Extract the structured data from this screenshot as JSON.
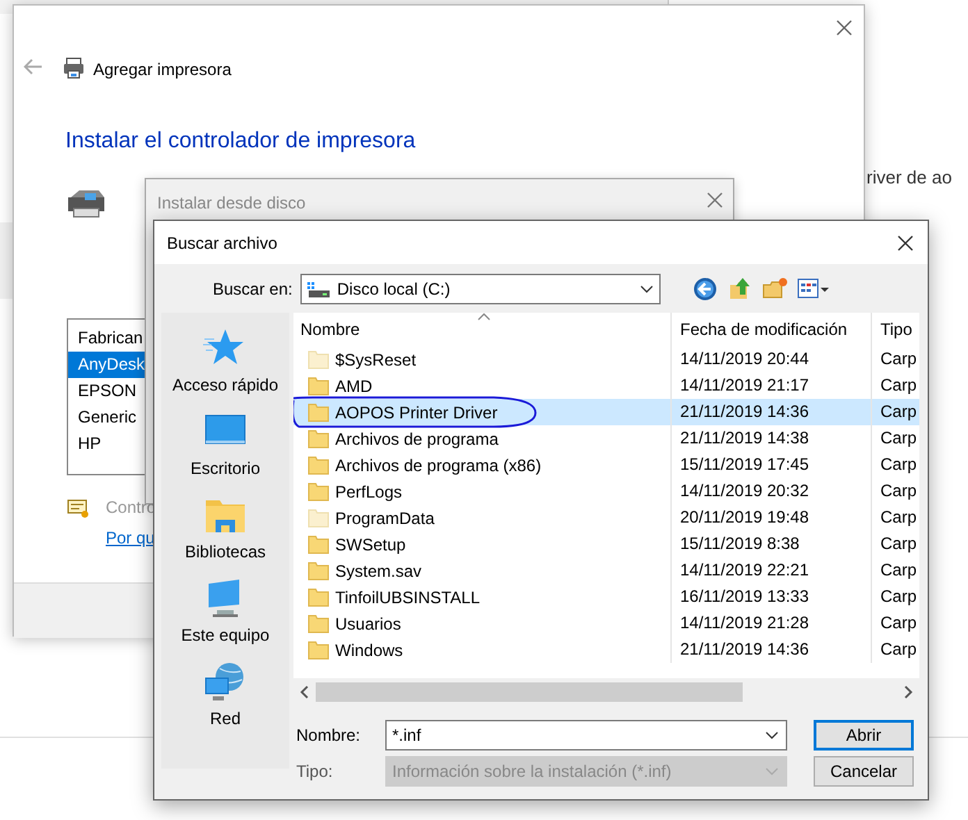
{
  "background": {
    "fragments": [
      "river de ao"
    ]
  },
  "add_printer_window": {
    "title": "Agregar impresora",
    "heading": "Instalar el controlador de impresora",
    "manufacturer_list": {
      "header": "Fabrican",
      "items": [
        {
          "label": "AnyDesk",
          "selected": true
        },
        {
          "label": "EPSON",
          "selected": false
        },
        {
          "label": "Generic",
          "selected": false
        },
        {
          "label": "HP",
          "selected": false
        }
      ]
    },
    "signed_text": "Contro",
    "link": "Por qu"
  },
  "install_from_disk_window": {
    "title": "Instalar desde disco"
  },
  "browse_dialog": {
    "title": "Buscar archivo",
    "look_in_label": "Buscar en:",
    "look_in_value": "Disco local (C:)",
    "places": [
      {
        "kind": "quick",
        "label": "Acceso rápido"
      },
      {
        "kind": "desktop",
        "label": "Escritorio"
      },
      {
        "kind": "libraries",
        "label": "Bibliotecas"
      },
      {
        "kind": "computer",
        "label": "Este equipo"
      },
      {
        "kind": "network",
        "label": "Red"
      }
    ],
    "columns": [
      "Nombre",
      "Fecha de modificación",
      "Tipo"
    ],
    "rows": [
      {
        "name": "$SysReset",
        "date": "14/11/2019 20:44",
        "type": "Carp",
        "hidden": true,
        "selected": false
      },
      {
        "name": "AMD",
        "date": "14/11/2019 21:17",
        "type": "Carp",
        "hidden": false,
        "selected": false
      },
      {
        "name": "AOPOS Printer Driver",
        "date": "21/11/2019 14:36",
        "type": "Carp",
        "hidden": false,
        "selected": true
      },
      {
        "name": "Archivos de programa",
        "date": "21/11/2019 14:38",
        "type": "Carp",
        "hidden": false,
        "selected": false
      },
      {
        "name": "Archivos de programa (x86)",
        "date": "15/11/2019 17:45",
        "type": "Carp",
        "hidden": false,
        "selected": false
      },
      {
        "name": "PerfLogs",
        "date": "14/11/2019 20:32",
        "type": "Carp",
        "hidden": false,
        "selected": false
      },
      {
        "name": "ProgramData",
        "date": "20/11/2019 19:48",
        "type": "Carp",
        "hidden": true,
        "selected": false
      },
      {
        "name": "SWSetup",
        "date": "15/11/2019 8:38",
        "type": "Carp",
        "hidden": false,
        "selected": false
      },
      {
        "name": "System.sav",
        "date": "14/11/2019 22:21",
        "type": "Carp",
        "hidden": false,
        "selected": false
      },
      {
        "name": "TinfoilUBSINSTALL",
        "date": "16/11/2019 13:33",
        "type": "Carp",
        "hidden": false,
        "selected": false
      },
      {
        "name": "Usuarios",
        "date": "14/11/2019 21:28",
        "type": "Carp",
        "hidden": false,
        "selected": false
      },
      {
        "name": "Windows",
        "date": "21/11/2019 14:36",
        "type": "Carp",
        "hidden": false,
        "selected": false
      }
    ],
    "filename_label": "Nombre:",
    "filename_value": "*.inf",
    "type_label": "Tipo:",
    "type_value": "Información sobre la instalación (*.inf)",
    "type_disabled": true,
    "buttons": [
      {
        "label": "Abrir",
        "default": true
      },
      {
        "label": "Cancelar",
        "default": false
      }
    ]
  }
}
